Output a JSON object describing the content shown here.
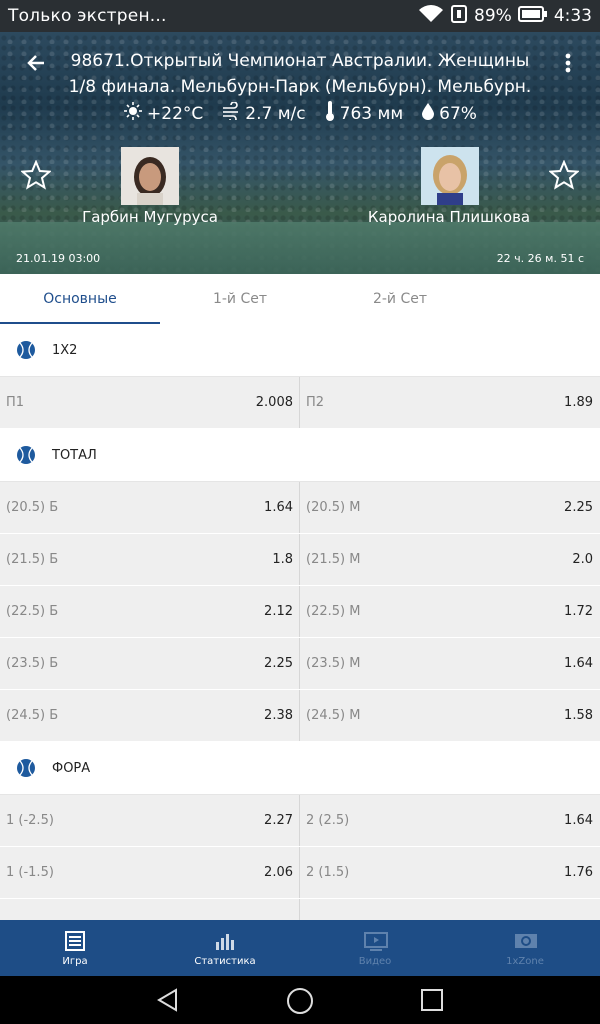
{
  "status_bar": {
    "notification": "Только экстрен...",
    "battery": "89%",
    "time": "4:33"
  },
  "header": {
    "title_line1": "98671.Открытый Чемпионат Австралии. Женщины",
    "title_line2": "1/8 финала. Мельбурн-Парк (Мельбурн). Мельбурн.",
    "weather": {
      "temp": "+22°C",
      "wind": "2.7 м/с",
      "pressure": "763 мм",
      "humidity": "67%"
    },
    "player1": "Гарбин Мугуруса",
    "player2": "Каролина Плишкова",
    "date": "21.01.19 03:00",
    "countdown": "22 ч. 26 м. 51 с"
  },
  "tabs": [
    "Основные",
    "1-й Сет",
    "2-й Сет"
  ],
  "sections": [
    {
      "title": "1X2",
      "rows": [
        [
          {
            "name": "П1",
            "odd": "2.008"
          },
          {
            "name": "П2",
            "odd": "1.89"
          }
        ]
      ]
    },
    {
      "title": "ТОТАЛ",
      "rows": [
        [
          {
            "name": "(20.5) Б",
            "odd": "1.64"
          },
          {
            "name": "(20.5) М",
            "odd": "2.25"
          }
        ],
        [
          {
            "name": "(21.5) Б",
            "odd": "1.8"
          },
          {
            "name": "(21.5) М",
            "odd": "2.0"
          }
        ],
        [
          {
            "name": "(22.5) Б",
            "odd": "2.12"
          },
          {
            "name": "(22.5) М",
            "odd": "1.72"
          }
        ],
        [
          {
            "name": "(23.5) Б",
            "odd": "2.25"
          },
          {
            "name": "(23.5) М",
            "odd": "1.64"
          }
        ],
        [
          {
            "name": "(24.5) Б",
            "odd": "2.38"
          },
          {
            "name": "(24.5) М",
            "odd": "1.58"
          }
        ]
      ]
    },
    {
      "title": "ФОРА",
      "rows": [
        [
          {
            "name": "1 (-2.5)",
            "odd": "2.27"
          },
          {
            "name": "2 (2.5)",
            "odd": "1.64"
          }
        ],
        [
          {
            "name": "1 (-1.5)",
            "odd": "2.06"
          },
          {
            "name": "2 (1.5)",
            "odd": "1.76"
          }
        ],
        [
          {
            "name": "",
            "odd": ""
          },
          {
            "name": "",
            "odd": ""
          }
        ]
      ]
    }
  ],
  "bottom_nav": [
    {
      "label": "Игра",
      "icon": "list-icon"
    },
    {
      "label": "Статистика",
      "icon": "bar-chart-icon"
    },
    {
      "label": "Видео",
      "icon": "video-icon"
    },
    {
      "label": "1xZone",
      "icon": "zone-icon"
    }
  ],
  "colors": {
    "primary": "#1e4d86",
    "accent_tab": "#1f4e8c",
    "row_bg": "#efefef"
  }
}
